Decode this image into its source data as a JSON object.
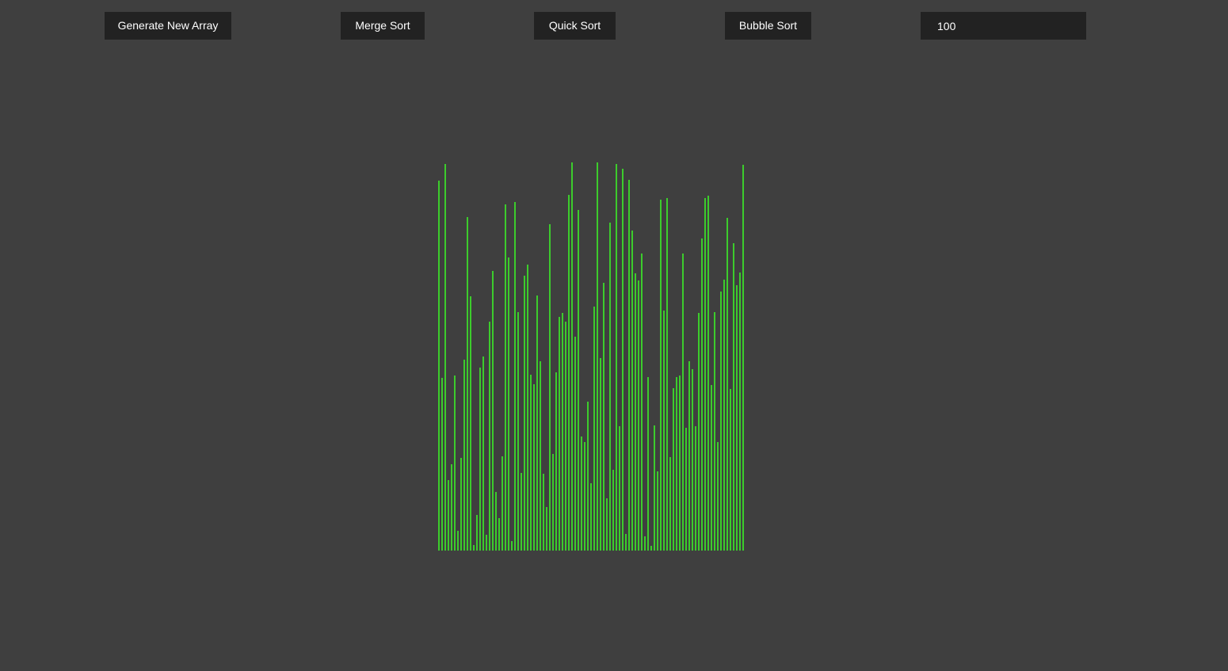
{
  "toolbar": {
    "generate_label": "Generate New Array",
    "merge_label": "Merge Sort",
    "quick_label": "Quick Sort",
    "bubble_label": "Bubble Sort",
    "size_value": "100"
  },
  "colors": {
    "background": "#3f3f3f",
    "button": "#222222",
    "button_text": "#ffffff",
    "bar": "#3ccc2c"
  },
  "chart_data": {
    "type": "bar",
    "ylim": [
      0,
      500
    ],
    "values": [
      467,
      218,
      488,
      89,
      109,
      221,
      25,
      117,
      241,
      421,
      321,
      7,
      45,
      231,
      245,
      20,
      289,
      353,
      74,
      41,
      119,
      437,
      370,
      12,
      440,
      301,
      98,
      347,
      361,
      222,
      210,
      322,
      239,
      97,
      55,
      412,
      122,
      225,
      295,
      300,
      289,
      449,
      490,
      270,
      430,
      144,
      137,
      188,
      85,
      308,
      490,
      243,
      338,
      66,
      414,
      102,
      488,
      157,
      482,
      21,
      468,
      404,
      350,
      341,
      375,
      18,
      219,
      6,
      158,
      100,
      443,
      303,
      445,
      118,
      205,
      219,
      221,
      375,
      155,
      239,
      229,
      157,
      300,
      394,
      445,
      448,
      209,
      301,
      137,
      327,
      342,
      420,
      204,
      388,
      335,
      351,
      487
    ]
  }
}
